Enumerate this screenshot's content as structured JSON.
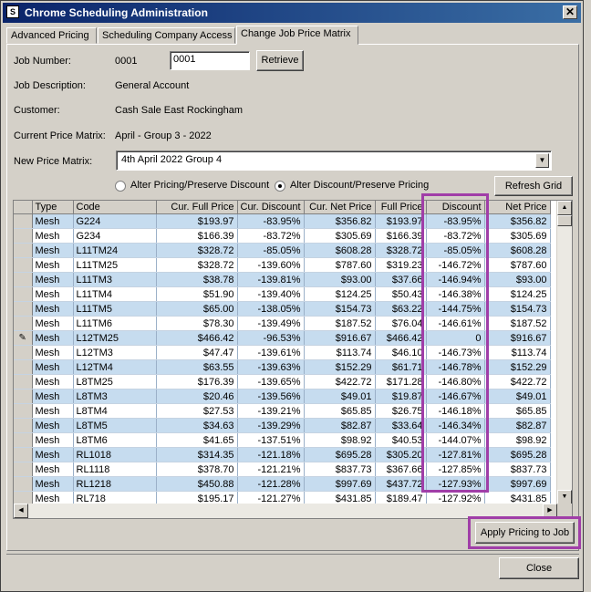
{
  "window": {
    "title": "Chrome Scheduling Administration",
    "close_glyph": "✕",
    "app_icon_glyph": "S"
  },
  "tabs": [
    {
      "label": "Advanced Pricing"
    },
    {
      "label": "Scheduling Company Access"
    },
    {
      "label": "Change Job Price Matrix"
    }
  ],
  "form": {
    "job_number_label": "Job Number:",
    "job_number_value": "0001",
    "job_number_input": "0001",
    "retrieve_label": "Retrieve",
    "job_description_label": "Job Description:",
    "job_description_value": "General Account",
    "customer_label": "Customer:",
    "customer_value": "Cash Sale East Rockingham",
    "current_matrix_label": "Current Price Matrix:",
    "current_matrix_value": "April - Group 3 - 2022",
    "new_matrix_label": "New Price Matrix:",
    "new_matrix_value": "4th April 2022 Group 4",
    "radio_alter_pricing": "Alter Pricing/Preserve Discount",
    "radio_alter_discount": "Alter Discount/Preserve Pricing",
    "selected_radio": "alter_discount",
    "refresh_label": "Refresh Grid"
  },
  "grid": {
    "columns": [
      "Type",
      "Code",
      "Cur. Full Price",
      "Cur. Discount",
      "Cur. Net Price",
      "Full Price",
      "Discount",
      "Net Price"
    ],
    "rows": [
      [
        "Mesh",
        "G224",
        "$193.97",
        "-83.95%",
        "$356.82",
        "$193.97",
        "-83.95%",
        "$356.82"
      ],
      [
        "Mesh",
        "G234",
        "$166.39",
        "-83.72%",
        "$305.69",
        "$166.39",
        "-83.72%",
        "$305.69"
      ],
      [
        "Mesh",
        "L11TM24",
        "$328.72",
        "-85.05%",
        "$608.28",
        "$328.72",
        "-85.05%",
        "$608.28"
      ],
      [
        "Mesh",
        "L11TM25",
        "$328.72",
        "-139.60%",
        "$787.60",
        "$319.23",
        "-146.72%",
        "$787.60"
      ],
      [
        "Mesh",
        "L11TM3",
        "$38.78",
        "-139.81%",
        "$93.00",
        "$37.66",
        "-146.94%",
        "$93.00"
      ],
      [
        "Mesh",
        "L11TM4",
        "$51.90",
        "-139.40%",
        "$124.25",
        "$50.43",
        "-146.38%",
        "$124.25"
      ],
      [
        "Mesh",
        "L11TM5",
        "$65.00",
        "-138.05%",
        "$154.73",
        "$63.22",
        "-144.75%",
        "$154.73"
      ],
      [
        "Mesh",
        "L11TM6",
        "$78.30",
        "-139.49%",
        "$187.52",
        "$76.04",
        "-146.61%",
        "$187.52"
      ],
      [
        "Mesh",
        "L12TM25",
        "$466.42",
        "-96.53%",
        "$916.67",
        "$466.42",
        "0",
        "$916.67"
      ],
      [
        "Mesh",
        "L12TM3",
        "$47.47",
        "-139.61%",
        "$113.74",
        "$46.10",
        "-146.73%",
        "$113.74"
      ],
      [
        "Mesh",
        "L12TM4",
        "$63.55",
        "-139.63%",
        "$152.29",
        "$61.71",
        "-146.78%",
        "$152.29"
      ],
      [
        "Mesh",
        "L8TM25",
        "$176.39",
        "-139.65%",
        "$422.72",
        "$171.28",
        "-146.80%",
        "$422.72"
      ],
      [
        "Mesh",
        "L8TM3",
        "$20.46",
        "-139.56%",
        "$49.01",
        "$19.87",
        "-146.67%",
        "$49.01"
      ],
      [
        "Mesh",
        "L8TM4",
        "$27.53",
        "-139.21%",
        "$65.85",
        "$26.75",
        "-146.18%",
        "$65.85"
      ],
      [
        "Mesh",
        "L8TM5",
        "$34.63",
        "-139.29%",
        "$82.87",
        "$33.64",
        "-146.34%",
        "$82.87"
      ],
      [
        "Mesh",
        "L8TM6",
        "$41.65",
        "-137.51%",
        "$98.92",
        "$40.53",
        "-144.07%",
        "$98.92"
      ],
      [
        "Mesh",
        "RL1018",
        "$314.35",
        "-121.18%",
        "$695.28",
        "$305.20",
        "-127.81%",
        "$695.28"
      ],
      [
        "Mesh",
        "RL1118",
        "$378.70",
        "-121.21%",
        "$837.73",
        "$367.66",
        "-127.85%",
        "$837.73"
      ],
      [
        "Mesh",
        "RL1218",
        "$450.88",
        "-121.28%",
        "$997.69",
        "$437.72",
        "-127.93%",
        "$997.69"
      ],
      [
        "Mesh",
        "RL718",
        "$195.17",
        "-121.27%",
        "$431.85",
        "$189.47",
        "-127.92%",
        "$431.85"
      ]
    ],
    "editing_row": 8
  },
  "buttons": {
    "apply": "Apply Pricing to Job",
    "close": "Close"
  },
  "colors": {
    "highlight": "#a03ea8",
    "alt_row": "#c6dcef",
    "title_bar": "#0a246a"
  }
}
